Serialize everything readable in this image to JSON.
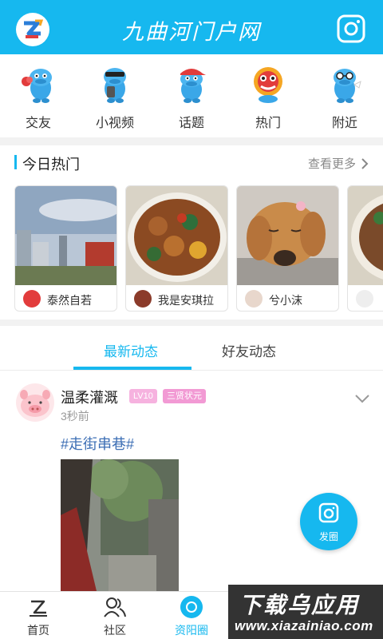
{
  "header": {
    "title": "九曲河门户网"
  },
  "categories": [
    {
      "label": "交友",
      "icon": "hippo-rose-icon"
    },
    {
      "label": "小视频",
      "icon": "hippo-phone-icon"
    },
    {
      "label": "话题",
      "icon": "hippo-cap-icon"
    },
    {
      "label": "热门",
      "icon": "lion-dance-icon"
    },
    {
      "label": "附近",
      "icon": "hippo-glasses-icon"
    }
  ],
  "hot": {
    "title": "今日热门",
    "more": "查看更多",
    "cards": [
      {
        "name": "泰然自若",
        "image": "city-skyline-image"
      },
      {
        "name": "我是安琪拉",
        "image": "braised-chicken-dish-image"
      },
      {
        "name": "兮小沫",
        "image": "golden-retriever-image"
      },
      {
        "name": "",
        "image": "noodle-soup-image"
      }
    ]
  },
  "tabs": {
    "active": "最新动态",
    "inactive": "好友动态"
  },
  "post": {
    "user": "温柔灌溉",
    "level": "LV10",
    "title_badge": "三贤状元",
    "time": "3秒前",
    "tag": "#走街串巷#"
  },
  "fab": {
    "label": "发圈"
  },
  "bottom_nav": [
    {
      "label": "首页",
      "icon": "home-logo-icon"
    },
    {
      "label": "社区",
      "icon": "community-icon"
    },
    {
      "label": "资阳圈",
      "icon": "circle-icon"
    }
  ],
  "watermark": {
    "main": "下载乌应用",
    "sub": "www.xiazainiao.com"
  },
  "colors": {
    "primary": "#16b8ef",
    "tag": "#3d6fb5",
    "badge": "#f29ad4"
  }
}
